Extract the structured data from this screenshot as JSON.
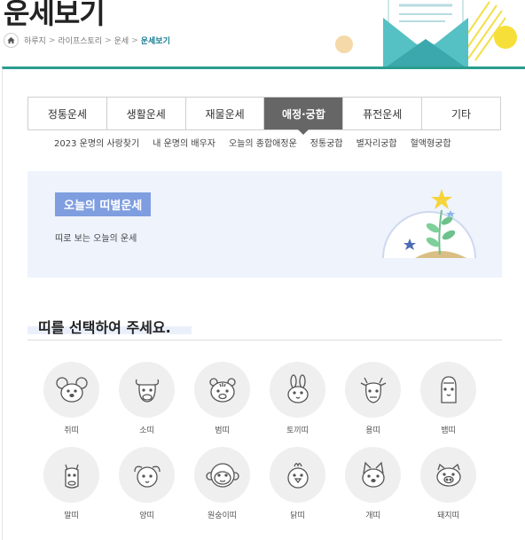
{
  "page": {
    "title": "운세보기"
  },
  "breadcrumb": {
    "items": [
      "하루지",
      "라이프스토리",
      "운세"
    ],
    "current": "운세보기",
    "sep": ">"
  },
  "tabs": [
    {
      "label": "정통운세",
      "active": false
    },
    {
      "label": "생활운세",
      "active": false
    },
    {
      "label": "재물운세",
      "active": false
    },
    {
      "label": "애정·궁합",
      "active": true
    },
    {
      "label": "퓨전운세",
      "active": false
    },
    {
      "label": "기타",
      "active": false
    }
  ],
  "subnav": [
    "2023 운명의 사랑찾기",
    "내 운명의 배우자",
    "오늘의 종합애정운",
    "정통궁합",
    "별자리궁합",
    "혈액형궁합"
  ],
  "banner": {
    "badge": "오늘의 띠별운세",
    "desc": "띠로 보는 오늘의 운세"
  },
  "section": {
    "heading": "띠를 선택하여 주세요."
  },
  "zodiac": [
    {
      "label": "쥐띠",
      "icon": "rat-icon"
    },
    {
      "label": "소띠",
      "icon": "ox-icon"
    },
    {
      "label": "범띠",
      "icon": "tiger-icon"
    },
    {
      "label": "토끼띠",
      "icon": "rabbit-icon"
    },
    {
      "label": "용띠",
      "icon": "dragon-icon"
    },
    {
      "label": "뱀띠",
      "icon": "snake-icon"
    },
    {
      "label": "말띠",
      "icon": "horse-icon"
    },
    {
      "label": "양띠",
      "icon": "sheep-icon"
    },
    {
      "label": "원숭이띠",
      "icon": "monkey-icon"
    },
    {
      "label": "닭띠",
      "icon": "rooster-icon"
    },
    {
      "label": "개띠",
      "icon": "dog-icon"
    },
    {
      "label": "돼지띠",
      "icon": "pig-icon"
    }
  ],
  "colors": {
    "accent": "#2a9d8f",
    "tab_active": "#666666",
    "badge": "#7f9ee0",
    "banner_bg": "#eef3fc",
    "breadcrumb_current": "#1a7c95"
  }
}
